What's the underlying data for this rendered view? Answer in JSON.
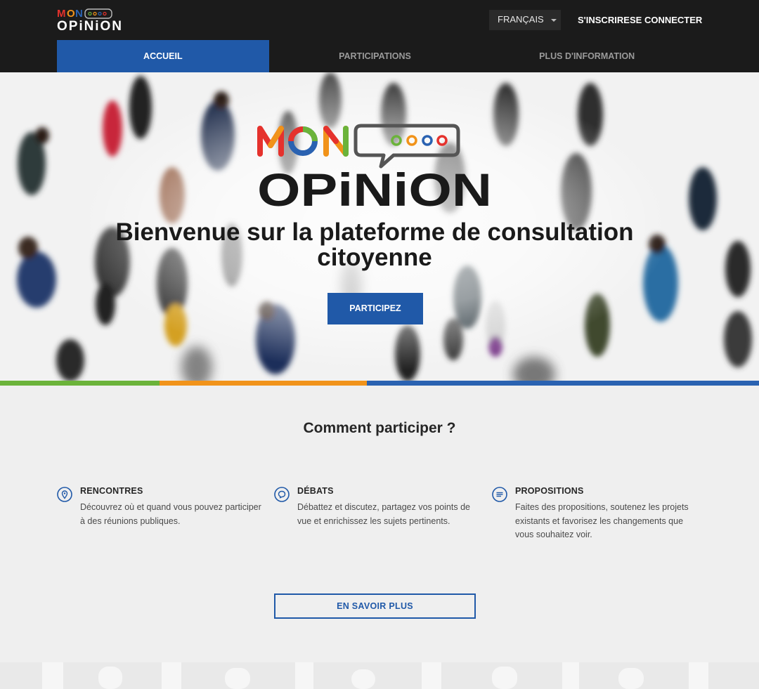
{
  "brand": {
    "line1": "MON",
    "line2": "OPiNiON",
    "colors": {
      "red": "#e5322d",
      "green": "#6bb33a",
      "orange": "#f1931a",
      "blue": "#2a62b1",
      "dark": "#1a1a1a"
    }
  },
  "header": {
    "language": "FRANÇAIS",
    "signup": "S'INSCRIRE",
    "login": "SE CONNECTER"
  },
  "nav": {
    "tabs": [
      {
        "label": "ACCUEIL",
        "active": true
      },
      {
        "label": "PARTICIPATIONS",
        "active": false
      },
      {
        "label": "PLUS D'INFORMATION",
        "active": false
      }
    ]
  },
  "hero": {
    "title": "Bienvenue sur la plateforme de consultation citoyenne",
    "cta": "PARTICIPEZ"
  },
  "stripes": [
    "#6bb33a",
    "#f1931a",
    "#2a62b1"
  ],
  "how": {
    "title": "Comment participer ?",
    "features": [
      {
        "icon": "location-pin-icon",
        "title": "RENCONTRES",
        "text": "Découvrez où et quand vous pouvez participer à des réunions publiques."
      },
      {
        "icon": "speech-bubble-icon",
        "title": "DÉBATS",
        "text": "Débattez et discutez, partagez vos points de vue et enrichissez les sujets pertinents."
      },
      {
        "icon": "list-lines-icon",
        "title": "PROPOSITIONS",
        "text": "Faites des propositions, soutenez les projets existants et favorisez les changements que vous souhaitez voir."
      }
    ],
    "more": "EN SAVOIR PLUS"
  },
  "theme": {
    "primary": "#2059a8",
    "header_bg": "#1b1b1b",
    "page_bg": "#efefef"
  }
}
